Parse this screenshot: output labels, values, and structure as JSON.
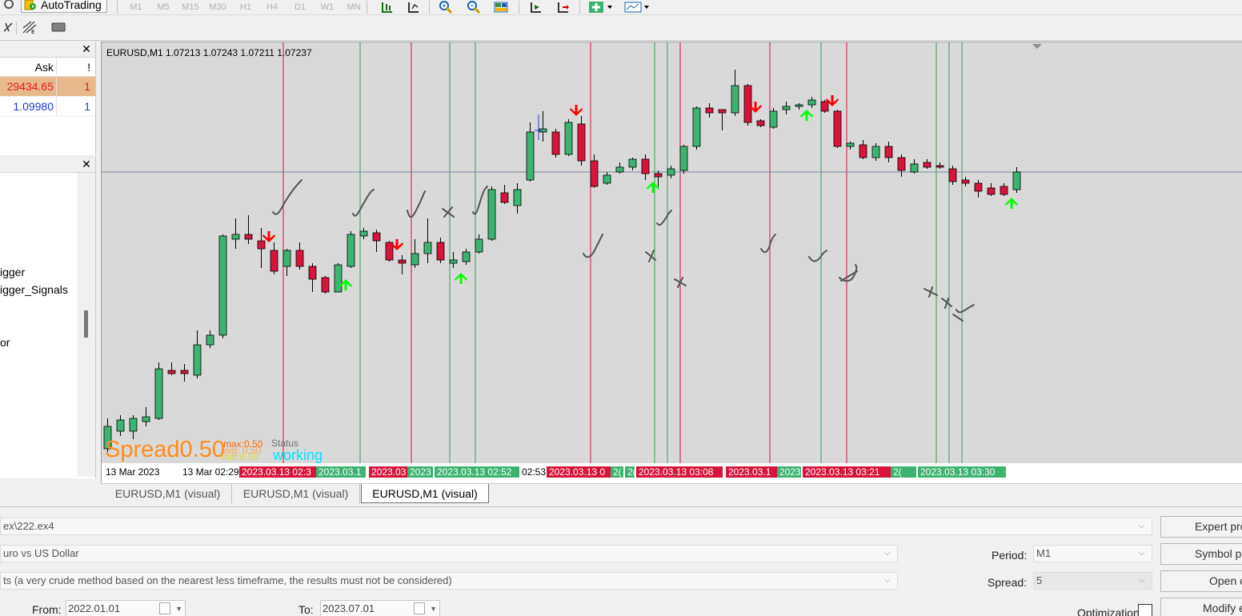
{
  "toolbar": {
    "autotrading_label": "AutoTrading",
    "timeframes": [
      "M1",
      "M5",
      "M15",
      "M30",
      "H1",
      "H4",
      "D1",
      "W1",
      "MN"
    ]
  },
  "icons": {
    "row1": [
      "chart-bars-icon",
      "chart-candles-icon",
      "zoom-in-icon",
      "zoom-out-icon",
      "tile-windows-icon",
      "autoscroll-icon",
      "chart-shift-icon",
      "indicators-icon",
      "templates-icon"
    ],
    "row2": [
      "crosshair-icon",
      "fibonacci-icon",
      "rectangle-icon"
    ]
  },
  "market_watch": {
    "close_glyph": "✕",
    "columns": [
      "Ask",
      "!"
    ],
    "rows": [
      {
        "ask": "29434.65",
        "flag": "1",
        "highlight": "#e8b98a",
        "color": "#e21d1d"
      },
      {
        "ask": "1.09980",
        "flag": "1",
        "highlight": "#ffffff",
        "color": "#1a3cc8"
      }
    ]
  },
  "navigator": {
    "close_glyph": "✕",
    "items": [
      "igger",
      "igger_Signals",
      "or"
    ]
  },
  "chart": {
    "info": "EURUSD,M1  1.07213 1.07243 1.07211 1.07237",
    "spread_label": "Spread",
    "spread_value": "0.50",
    "max_label": "max:0.50",
    "avg_label": "avg: 0.50",
    "min_label": "min:0.50",
    "status_label": "Status",
    "status_value": "working",
    "colors": {
      "background": "#d9d9d9",
      "bull": "#3cb371",
      "bear": "#d7143c",
      "buy_arrow": "#00ff00",
      "sell_arrow": "#ff0000",
      "spread": "#ff8c1a",
      "status": "#00e5ff"
    },
    "time_labels": [
      {
        "text": "13 Mar 2023",
        "bg": ""
      },
      {
        "text": "13 Mar 02:29",
        "bg": ""
      },
      {
        "text": "2023.03.13 02:3",
        "bg": "#d7143c"
      },
      {
        "text": "2023.03.1",
        "bg": "#3cb371"
      },
      {
        "text": "2023.03",
        "bg": "#d7143c"
      },
      {
        "text": "2023",
        "bg": "#3cb371"
      },
      {
        "text": "2023.03.13 02:52",
        "bg": "#3cb371"
      },
      {
        "text": "02:53",
        "bg": ""
      },
      {
        "text": "2023.03.13 0",
        "bg": "#d7143c"
      },
      {
        "text": "2(",
        "bg": "#3cb371"
      },
      {
        "text": "2(",
        "bg": "#3cb371"
      },
      {
        "text": "2023.03.13 03:08",
        "bg": "#d7143c"
      },
      {
        "text": "2023.03.1",
        "bg": "#d7143c"
      },
      {
        "text": "2023",
        "bg": "#3cb371"
      },
      {
        "text": "2023.03.13 03:21",
        "bg": "#d7143c"
      },
      {
        "text": "2(",
        "bg": "#3cb371"
      },
      {
        "text": "2023.03.13 03:30",
        "bg": "#3cb371"
      }
    ]
  },
  "tabs": [
    "EURUSD,M1 (visual)",
    "EURUSD,M1 (visual)",
    "EURUSD,M1 (visual)"
  ],
  "tester": {
    "expert_value": "ex\\222.ex4",
    "symbol_value": "uro vs US Dollar",
    "model_value": "ts (a very crude method based on the nearest less timeframe, the results must not be considered)",
    "period_label": "Period:",
    "period_value": "M1",
    "spread_label": "Spread:",
    "spread_value": "5",
    "from_label": "From:",
    "from_value": "2022.01.01",
    "to_label": "To:",
    "to_value": "2023.07.01",
    "optimization_label": "Optimization",
    "buttons": [
      "Expert pro",
      "Symbol pro",
      "Open c",
      "Modify e"
    ]
  }
}
